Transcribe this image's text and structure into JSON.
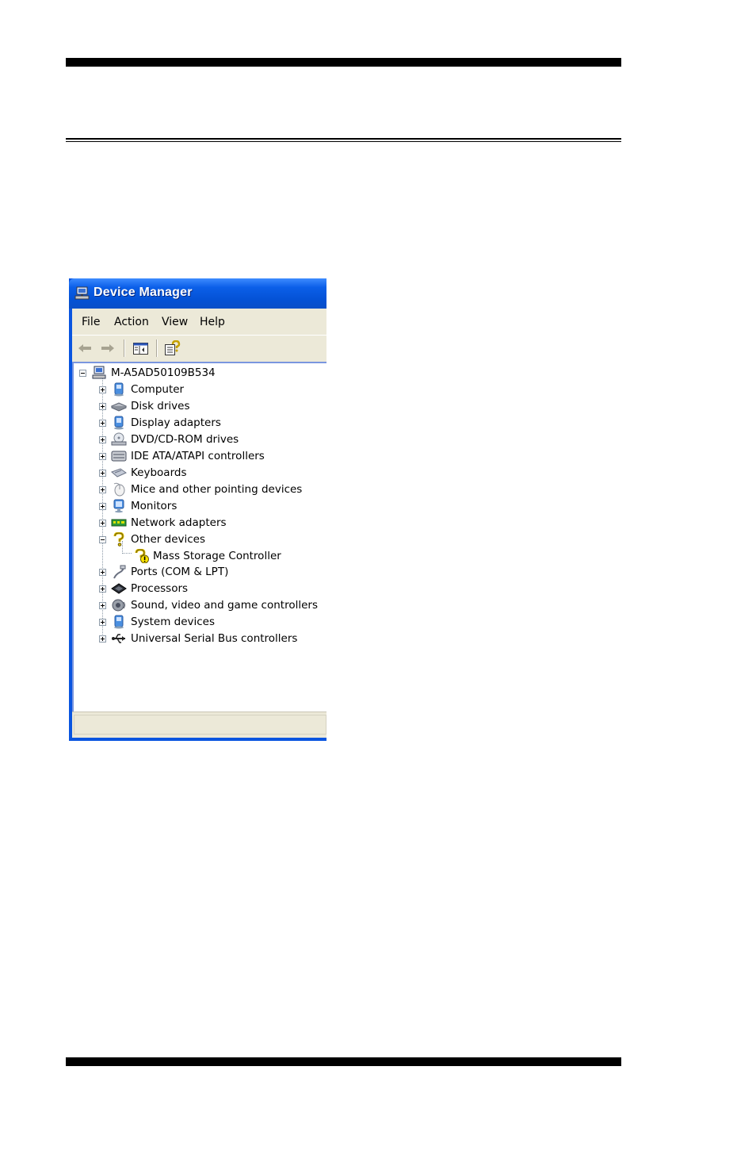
{
  "window": {
    "title": "Device Manager"
  },
  "menu": [
    "File",
    "Action",
    "View",
    "Help"
  ],
  "toolbar": {
    "buttons": [
      "back-arrow-icon",
      "forward-arrow-icon",
      "show-hide-console-tree-icon",
      "help-properties-icon"
    ]
  },
  "tree": {
    "root": "M-A5AD50109B534",
    "items": [
      {
        "label": "Computer",
        "icon": "computer-icon"
      },
      {
        "label": "Disk drives",
        "icon": "disk-drive-icon"
      },
      {
        "label": "Display adapters",
        "icon": "display-adapter-icon"
      },
      {
        "label": "DVD/CD-ROM drives",
        "icon": "dvd-drive-icon"
      },
      {
        "label": "IDE ATA/ATAPI controllers",
        "icon": "ide-controller-icon"
      },
      {
        "label": "Keyboards",
        "icon": "keyboard-icon"
      },
      {
        "label": "Mice and other pointing devices",
        "icon": "mouse-icon"
      },
      {
        "label": "Monitors",
        "icon": "monitor-icon"
      },
      {
        "label": "Network adapters",
        "icon": "network-adapter-icon"
      },
      {
        "label": "Other devices",
        "icon": "unknown-device-icon",
        "expanded": true
      },
      {
        "label": "Mass Storage Controller",
        "icon": "warning-device-icon",
        "child": true
      },
      {
        "label": "Ports (COM & LPT)",
        "icon": "port-icon"
      },
      {
        "label": "Processors",
        "icon": "processor-icon"
      },
      {
        "label": "Sound, video and game controllers",
        "icon": "sound-icon"
      },
      {
        "label": "System devices",
        "icon": "system-device-icon"
      },
      {
        "label": "Universal Serial Bus controllers",
        "icon": "usb-icon"
      }
    ]
  },
  "colors": {
    "titlebar": "#0452d6",
    "chrome": "#ece9d8",
    "border": "#0a55e0"
  }
}
